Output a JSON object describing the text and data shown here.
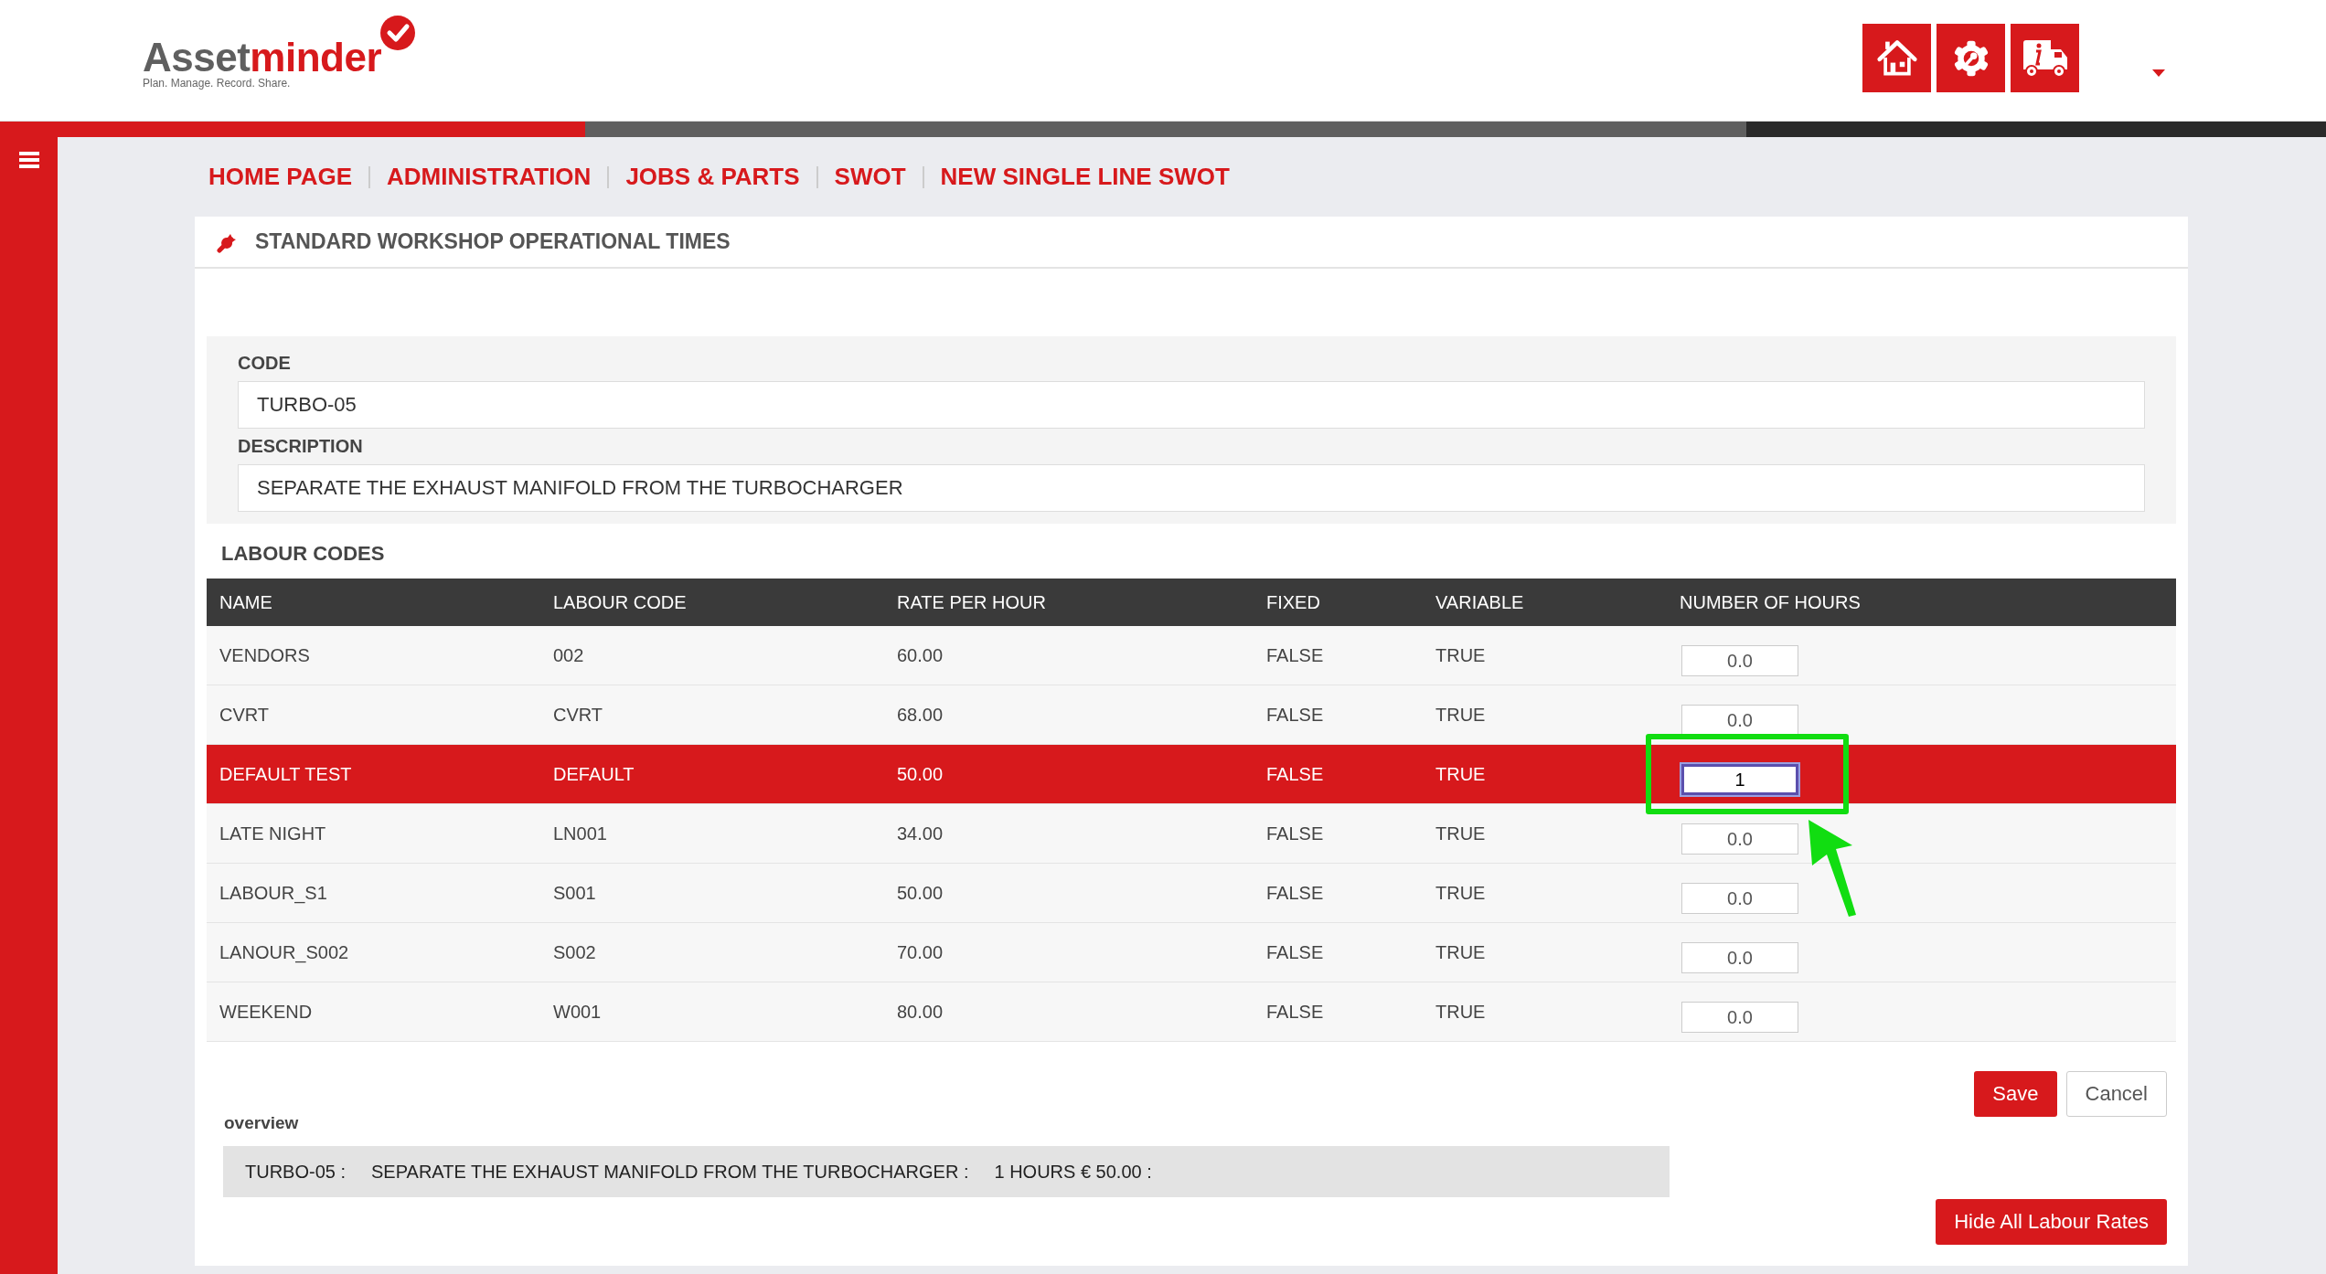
{
  "logo": {
    "prefix": "Asset",
    "suffix": "minder",
    "tagline": "Plan. Manage. Record. Share."
  },
  "breadcrumb": [
    {
      "label": "HOME PAGE"
    },
    {
      "label": "ADMINISTRATION"
    },
    {
      "label": "JOBS & PARTS"
    },
    {
      "label": "SWOT"
    },
    {
      "label": "NEW SINGLE LINE SWOT"
    }
  ],
  "card": {
    "title": "STANDARD WORKSHOP OPERATIONAL TIMES"
  },
  "form": {
    "code_label": "CODE",
    "code_value": "TURBO-05",
    "description_label": "DESCRIPTION",
    "description_value": "SEPARATE THE EXHAUST MANIFOLD FROM THE TURBOCHARGER"
  },
  "labour_codes": {
    "title": "LABOUR CODES",
    "columns": [
      "NAME",
      "LABOUR CODE",
      "RATE PER HOUR",
      "FIXED",
      "VARIABLE",
      "NUMBER OF HOURS"
    ],
    "rows": [
      {
        "name": "VENDORS",
        "code": "002",
        "rate": "60.00",
        "fixed": "FALSE",
        "variable": "TRUE",
        "hours": "0.0",
        "selected": false
      },
      {
        "name": "CVRT",
        "code": "CVRT",
        "rate": "68.00",
        "fixed": "FALSE",
        "variable": "TRUE",
        "hours": "0.0",
        "selected": false
      },
      {
        "name": "DEFAULT TEST",
        "code": "DEFAULT",
        "rate": "50.00",
        "fixed": "FALSE",
        "variable": "TRUE",
        "hours": "1",
        "selected": true
      },
      {
        "name": "LATE NIGHT",
        "code": "LN001",
        "rate": "34.00",
        "fixed": "FALSE",
        "variable": "TRUE",
        "hours": "0.0",
        "selected": false
      },
      {
        "name": "LABOUR_S1",
        "code": "S001",
        "rate": "50.00",
        "fixed": "FALSE",
        "variable": "TRUE",
        "hours": "0.0",
        "selected": false
      },
      {
        "name": "LANOUR_S002",
        "code": "S002",
        "rate": "70.00",
        "fixed": "FALSE",
        "variable": "TRUE",
        "hours": "0.0",
        "selected": false
      },
      {
        "name": "WEEKEND",
        "code": "W001",
        "rate": "80.00",
        "fixed": "FALSE",
        "variable": "TRUE",
        "hours": "0.0",
        "selected": false
      }
    ]
  },
  "buttons": {
    "save": "Save",
    "cancel": "Cancel",
    "hide": "Hide All Labour Rates"
  },
  "overview": {
    "label": "overview",
    "parts": [
      "TURBO-05 :",
      "SEPARATE THE EXHAUST MANIFOLD FROM THE TURBOCHARGER :",
      "1 HOURS € 50.00 :"
    ]
  }
}
